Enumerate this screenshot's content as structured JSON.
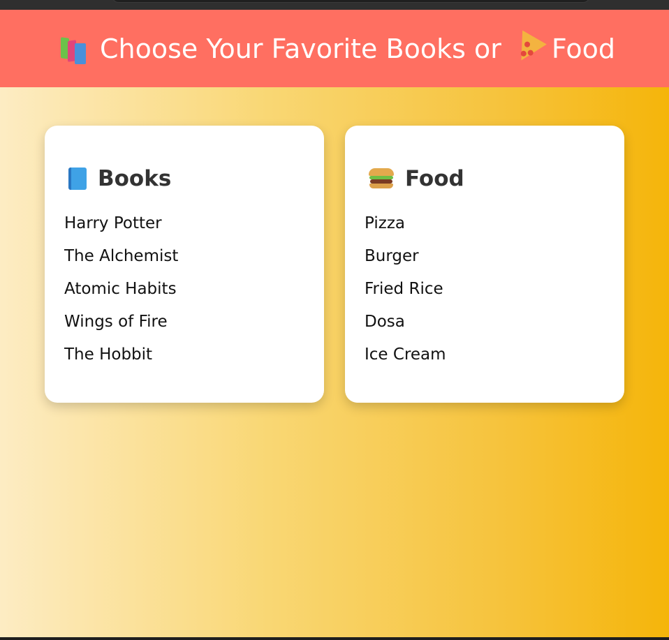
{
  "header": {
    "title_part1": "Choose Your Favorite Books or",
    "title_part2": "Food",
    "icon_left": "books-icon",
    "icon_right": "pizza-icon",
    "background_color": "#ff6f61"
  },
  "books": {
    "heading": "Books",
    "icon": "blue-book-icon",
    "items": [
      "Harry Potter",
      "The Alchemist",
      "Atomic Habits",
      "Wings of Fire",
      "The Hobbit"
    ]
  },
  "food": {
    "heading": "Food",
    "icon": "burger-icon",
    "items": [
      "Pizza",
      "Burger",
      "Fried Rice",
      "Dosa",
      "Ice Cream"
    ]
  },
  "colors": {
    "gradient_start": "#fdecc3",
    "gradient_end": "#f5b50a",
    "card_bg": "#ffffff"
  }
}
